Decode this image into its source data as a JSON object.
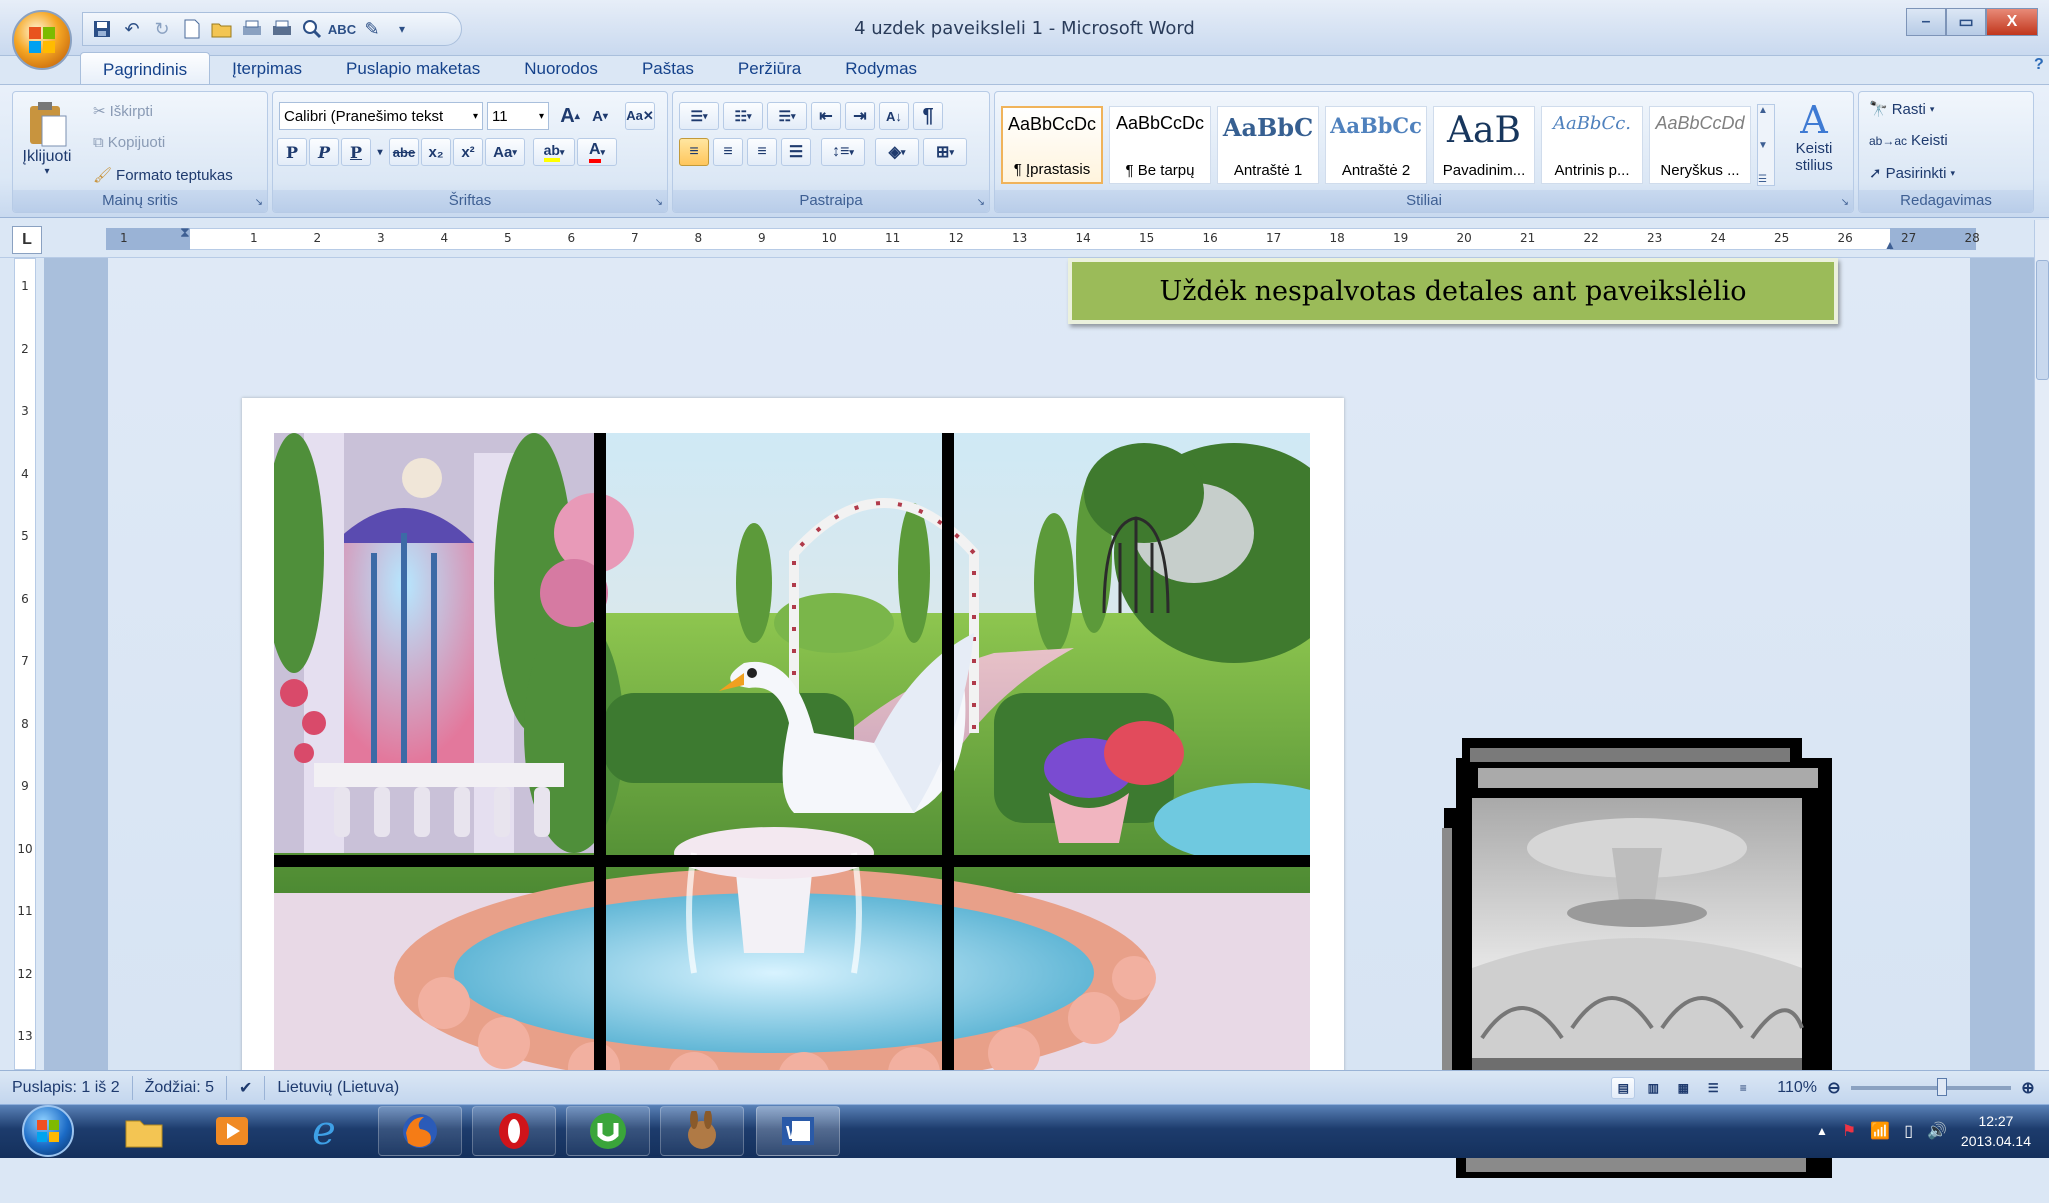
{
  "window": {
    "title": "4 uzdek paveiksleli 1 - Microsoft Word",
    "controls": {
      "minimize": "–",
      "maximize": "▭",
      "close": "X"
    }
  },
  "tabs": [
    "Pagrindinis",
    "Įterpimas",
    "Puslapio maketas",
    "Nuorodos",
    "Paštas",
    "Peržiūra",
    "Rodymas"
  ],
  "clipboard": {
    "paste": "Įklijuoti",
    "cut": "Iškirpti",
    "copy": "Kopijuoti",
    "format_painter": "Formato teptukas",
    "label": "Mainų sritis"
  },
  "font": {
    "name": "Calibri (Pranešimo tekst",
    "size": "11",
    "label": "Šriftas",
    "bold": "P",
    "italic": "P",
    "underline": "P",
    "strike": "abe",
    "subscript": "x₂",
    "superscript": "x²",
    "case": "Aa",
    "grow": "A",
    "shrink": "A"
  },
  "paragraph": {
    "label": "Pastraipa",
    "pilcrow": "¶"
  },
  "styles": {
    "label": "Stiliai",
    "items": [
      {
        "sample": "AaBbCcDc",
        "name": "¶ Įprastasis"
      },
      {
        "sample": "AaBbCcDc",
        "name": "¶ Be tarpų"
      },
      {
        "sample": "AaBbC",
        "name": "Antraštė 1"
      },
      {
        "sample": "AaBbCc",
        "name": "Antraštė 2"
      },
      {
        "sample": "AaB",
        "name": "Pavadinim..."
      },
      {
        "sample": "AaBbCc.",
        "name": "Antrinis p..."
      },
      {
        "sample": "AaBbCcDd",
        "name": "Neryškus ..."
      }
    ],
    "change_styles": "Keisti stilius"
  },
  "editing": {
    "label": "Redagavimas",
    "find": "Rasti",
    "replace": "Keisti",
    "select": "Pasirinkti"
  },
  "ruler": {
    "tab_selector": "L",
    "marks": [
      "1",
      "1",
      "2",
      "3",
      "4",
      "5",
      "6",
      "7",
      "8",
      "9",
      "10",
      "11",
      "12",
      "13",
      "14",
      "15",
      "16",
      "17",
      "18",
      "19",
      "20",
      "21",
      "22",
      "23",
      "24",
      "25",
      "26",
      "27",
      "28"
    ],
    "vmarks": [
      "1",
      "2",
      "3",
      "4",
      "5",
      "6",
      "7",
      "8",
      "9",
      "10",
      "11",
      "12",
      "13"
    ]
  },
  "document": {
    "heading": "Uždėk nespalvotas detales ant paveikslėlio"
  },
  "status": {
    "page": "Puslapis: 1 iš 2",
    "words": "Žodžiai: 5",
    "language": "Lietuvių (Lietuva)",
    "zoom": "110%"
  },
  "taskbar": {
    "time": "12:27",
    "date": "2013.04.14"
  },
  "colors": {
    "accent": "#15428b",
    "heading_box": "#9bbb59",
    "highlight": "#ffff00",
    "font_color": "#ff0000"
  }
}
